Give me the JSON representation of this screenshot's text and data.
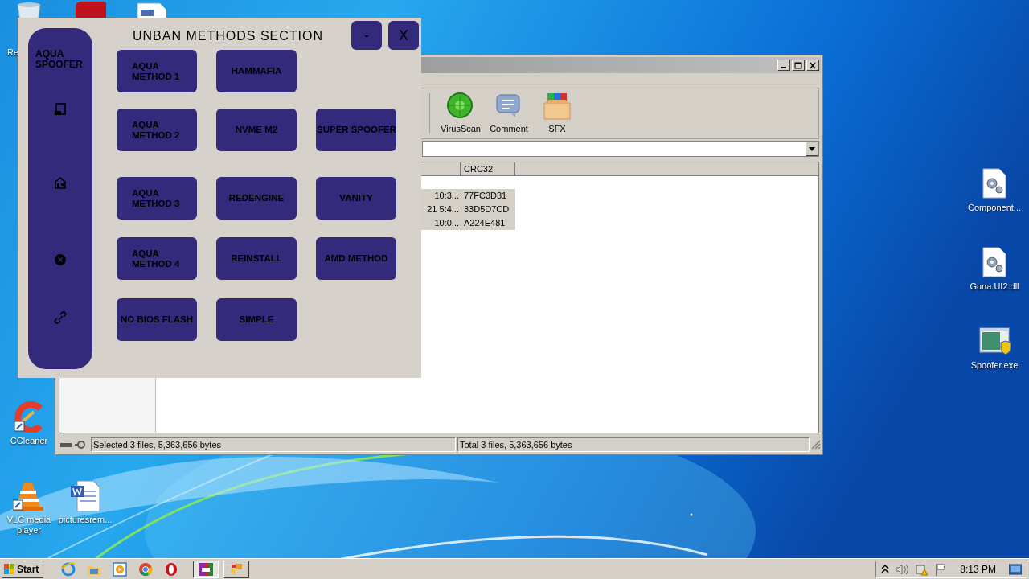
{
  "desktop_icons_left": [
    {
      "kind": "recycle",
      "label": "Re"
    },
    {
      "kind": "ccleaner",
      "label": "CCleaner"
    },
    {
      "kind": "vlc",
      "label": "VLC media player"
    },
    {
      "kind": "word",
      "label": "picturesrem..."
    }
  ],
  "desktop_icons_top": [
    {
      "kind": "app"
    },
    {
      "kind": "doc"
    }
  ],
  "desktop_icons_right": [
    {
      "kind": "dll",
      "label": "Component..."
    },
    {
      "kind": "dll",
      "label": "Guna.UI2.dll"
    },
    {
      "kind": "exe",
      "label": "Spoofer.exe"
    }
  ],
  "archiver": {
    "toolbar": [
      {
        "kind": "virus",
        "label": "VirusScan"
      },
      {
        "kind": "comment",
        "label": "Comment"
      },
      {
        "kind": "sfx",
        "label": "SFX"
      }
    ],
    "columns": [
      "CRC32"
    ],
    "rows": [
      {
        "column_1": "10:3...",
        "crc32": "77FC3D31",
        "selected": true
      },
      {
        "column_1": "21 5:4...",
        "crc32": "33D5D7CD",
        "selected": true
      },
      {
        "column_1": "10:0...",
        "crc32": "A224E481",
        "selected": true
      }
    ],
    "status_left": "Selected 3 files, 5,363,656 bytes",
    "status_right": "Total 3 files, 5,363,656 bytes"
  },
  "spoofer": {
    "brand": "AQUA\nSPOOFER",
    "title": "UNBAN METHODS SECTION",
    "minimize": "-",
    "close": "X",
    "nav": [
      {
        "kind": "tablet"
      },
      {
        "kind": "store"
      },
      {
        "kind": "x-circle"
      },
      {
        "kind": "link"
      }
    ],
    "button_rows": [
      [
        "AQUA\nMETHOD 1",
        "HAMMAFIA"
      ],
      [
        "AQUA\nMETHOD 2",
        "NVME M2",
        "SUPER SPOOFER"
      ],
      [
        "AQUA\nMETHOD 3",
        "REDENGINE",
        "VANITY"
      ],
      [
        "AQUA\nMETHOD 4",
        "REINSTALL",
        "AMD METHOD"
      ],
      [
        "NO BIOS FLASH",
        "SIMPLE"
      ]
    ]
  },
  "taskbar": {
    "start": "Start",
    "quick_launch": [
      {
        "kind": "ie"
      },
      {
        "kind": "folder"
      },
      {
        "kind": "player"
      },
      {
        "kind": "chrome"
      },
      {
        "kind": "opera"
      }
    ],
    "tasks": [
      {
        "kind": "winrar",
        "selected": true
      },
      {
        "kind": "app",
        "selected": false
      }
    ],
    "clock": "8:13 PM"
  }
}
